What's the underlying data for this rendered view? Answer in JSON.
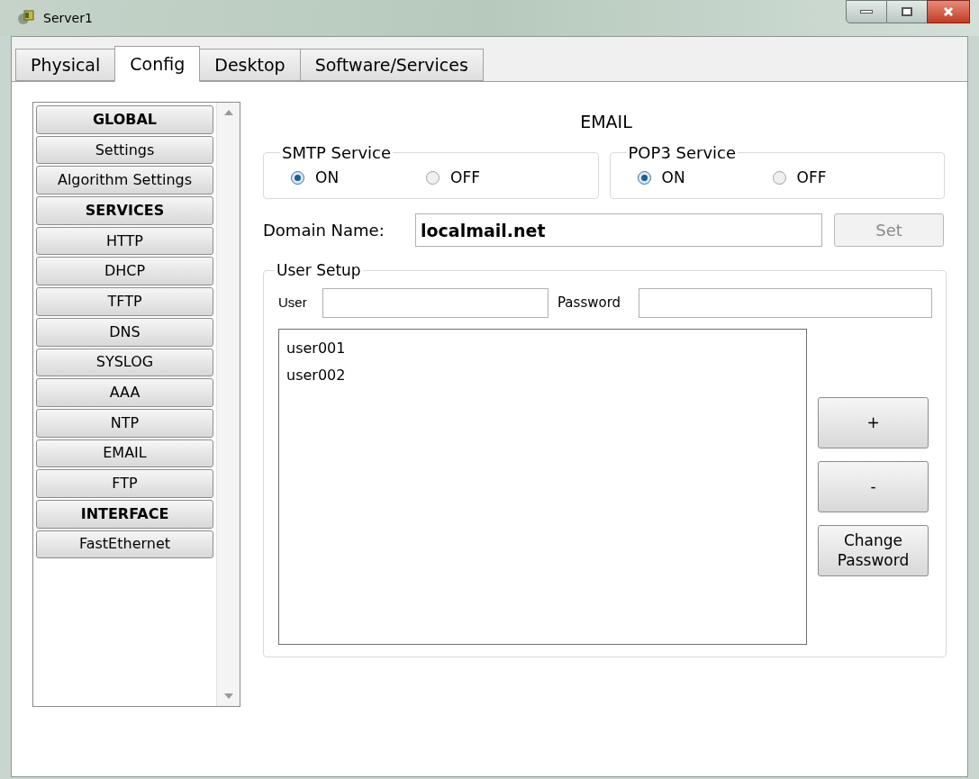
{
  "window": {
    "title": "Server1"
  },
  "tabs": [
    {
      "label": "Physical",
      "selected": false
    },
    {
      "label": "Config",
      "selected": true
    },
    {
      "label": "Desktop",
      "selected": false
    },
    {
      "label": "Software/Services",
      "selected": false
    }
  ],
  "sidebar": {
    "items": [
      {
        "kind": "header",
        "label": "GLOBAL"
      },
      {
        "kind": "item",
        "label": "Settings"
      },
      {
        "kind": "item",
        "label": "Algorithm Settings"
      },
      {
        "kind": "header",
        "label": "SERVICES"
      },
      {
        "kind": "item",
        "label": "HTTP"
      },
      {
        "kind": "item",
        "label": "DHCP"
      },
      {
        "kind": "item",
        "label": "TFTP"
      },
      {
        "kind": "item",
        "label": "DNS"
      },
      {
        "kind": "item",
        "label": "SYSLOG"
      },
      {
        "kind": "item",
        "label": "AAA"
      },
      {
        "kind": "item",
        "label": "NTP"
      },
      {
        "kind": "item",
        "label": "EMAIL"
      },
      {
        "kind": "item",
        "label": "FTP"
      },
      {
        "kind": "header",
        "label": "INTERFACE"
      },
      {
        "kind": "item",
        "label": "FastEthernet"
      }
    ]
  },
  "panel": {
    "title": "EMAIL",
    "services": [
      {
        "title": "SMTP Service",
        "options": [
          {
            "label": "ON",
            "selected": true
          },
          {
            "label": "OFF",
            "selected": false
          }
        ]
      },
      {
        "title": "POP3 Service",
        "options": [
          {
            "label": "ON",
            "selected": true
          },
          {
            "label": "OFF",
            "selected": false
          }
        ]
      }
    ],
    "domain": {
      "label": "Domain Name:",
      "value": "localmail.net",
      "button": {
        "label": "Set",
        "disabled": true
      }
    },
    "user_setup": {
      "title": "User Setup",
      "user_label": "User",
      "password_label": "Password",
      "users": [
        "user001",
        "user002"
      ],
      "buttons": [
        "+",
        "-",
        "Change Password"
      ]
    }
  }
}
